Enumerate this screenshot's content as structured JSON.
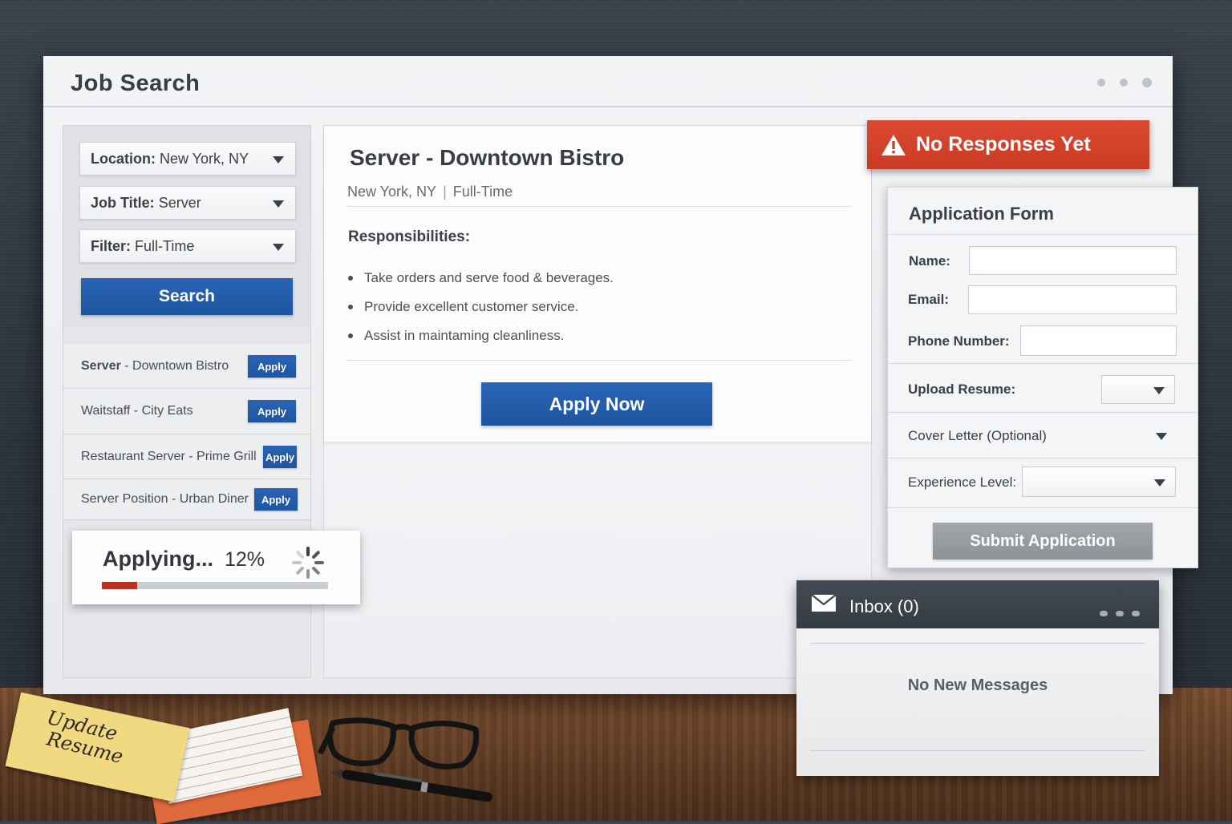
{
  "app": {
    "title": "Job Search"
  },
  "filters": {
    "location": {
      "label": "Location:",
      "value": "New York, NY"
    },
    "job_title": {
      "label": "Job Title:",
      "value": "Server"
    },
    "filter": {
      "label": "Filter:",
      "value": "Full-Time"
    },
    "search_label": "Search"
  },
  "job_list": [
    {
      "title": "Server",
      "sep": " - ",
      "company": "Downtown Bistro",
      "apply_label": "Apply"
    },
    {
      "title": "Waitstaff - City Eats",
      "apply_label": "Apply"
    },
    {
      "title": "Restaurant Server - Prime Grill",
      "apply_label": "Apply"
    },
    {
      "title": "Server Position - Urban Diner",
      "apply_label": "Apply"
    }
  ],
  "job_detail": {
    "title": "Server - Downtown Bistro",
    "location": "New York, NY",
    "type": "Full-Time",
    "responsibilities_heading": "Responsibilities:",
    "responsibilities": [
      "Take orders and serve food & beverages.",
      "Provide excellent customer service.",
      "Assist in maintaming cleanliness."
    ],
    "apply_now_label": "Apply Now"
  },
  "progress": {
    "label": "Applying...",
    "percent_text": "12%",
    "percent": 12,
    "bar_color": "#b8321f"
  },
  "alert": {
    "text": "No Responses Yet",
    "color": "#d4432c"
  },
  "application_form": {
    "title": "Application Form",
    "name_label": "Name:",
    "email_label": "Email:",
    "phone_label": "Phone Number:",
    "resume_label": "Upload Resume:",
    "cover_letter_label": "Cover Letter (Optional)",
    "experience_label": "Experience Level:",
    "submit_label": "Submit Application"
  },
  "inbox": {
    "title": "Inbox (0)",
    "empty_text": "No New Messages"
  },
  "desk": {
    "sticky_note_line1": "Update",
    "sticky_note_line2": "Resume"
  },
  "colors": {
    "primary": "#2360ae",
    "alert": "#d4432c",
    "submit_disabled": "#9a9ea3",
    "inbox_header": "#3d434b"
  },
  "icons": [
    "chevron-down-icon",
    "warning-icon",
    "spinner-icon",
    "mail-icon",
    "window-dots-icon"
  ]
}
